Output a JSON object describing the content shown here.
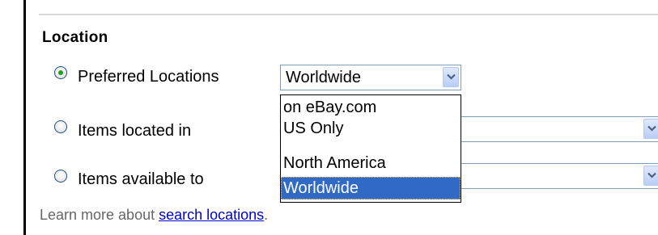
{
  "section": {
    "title": "Location"
  },
  "options": [
    {
      "label": "Preferred Locations",
      "selected": true
    },
    {
      "label": "Items located in",
      "selected": false
    },
    {
      "label": "Items available to",
      "selected": false
    }
  ],
  "preferred_select": {
    "value": "Worldwide",
    "options": [
      "on eBay.com",
      "US Only",
      "North America",
      "Worldwide"
    ],
    "highlighted": "Worldwide"
  },
  "located_select": {
    "value": ""
  },
  "available_select": {
    "value": ""
  },
  "footer": {
    "text": "Learn more about ",
    "link": "search locations",
    "suffix": "."
  },
  "colors": {
    "accent": "#316ac5",
    "link": "#0000cc",
    "radio_selected": "#21a121",
    "select_border": "#7f9db9"
  },
  "icons": {
    "dropdown": "chevron-down-icon",
    "radio": "radio-button-icon"
  }
}
